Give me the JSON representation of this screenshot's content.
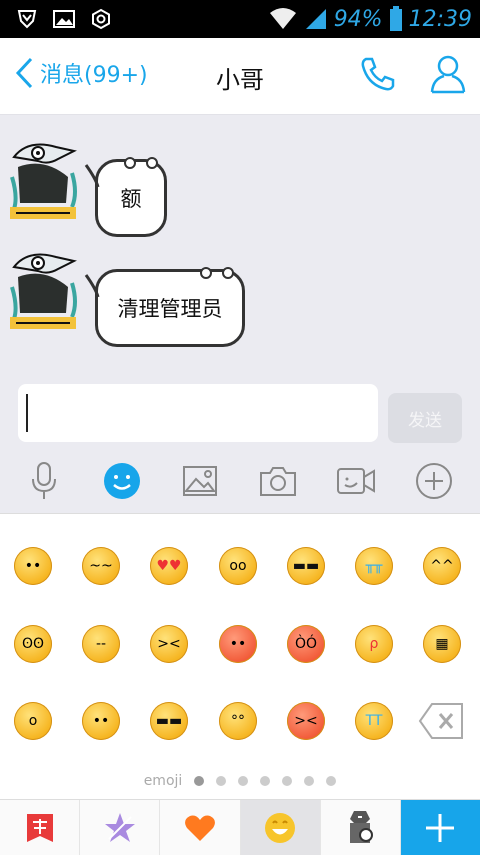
{
  "status_bar": {
    "battery": "94%",
    "time": "12:39"
  },
  "header": {
    "back_label": "消息(99+)",
    "title": "小哥"
  },
  "messages": [
    {
      "text": "额"
    },
    {
      "text": "清理管理员"
    }
  ],
  "composer": {
    "input_value": "",
    "send_label": "发送"
  },
  "emoji_panel": {
    "page_label": "emoji",
    "page_count": 7,
    "current_page": 1
  },
  "colors": {
    "accent": "#17a5ea",
    "chat_bg": "#ebebf1"
  }
}
